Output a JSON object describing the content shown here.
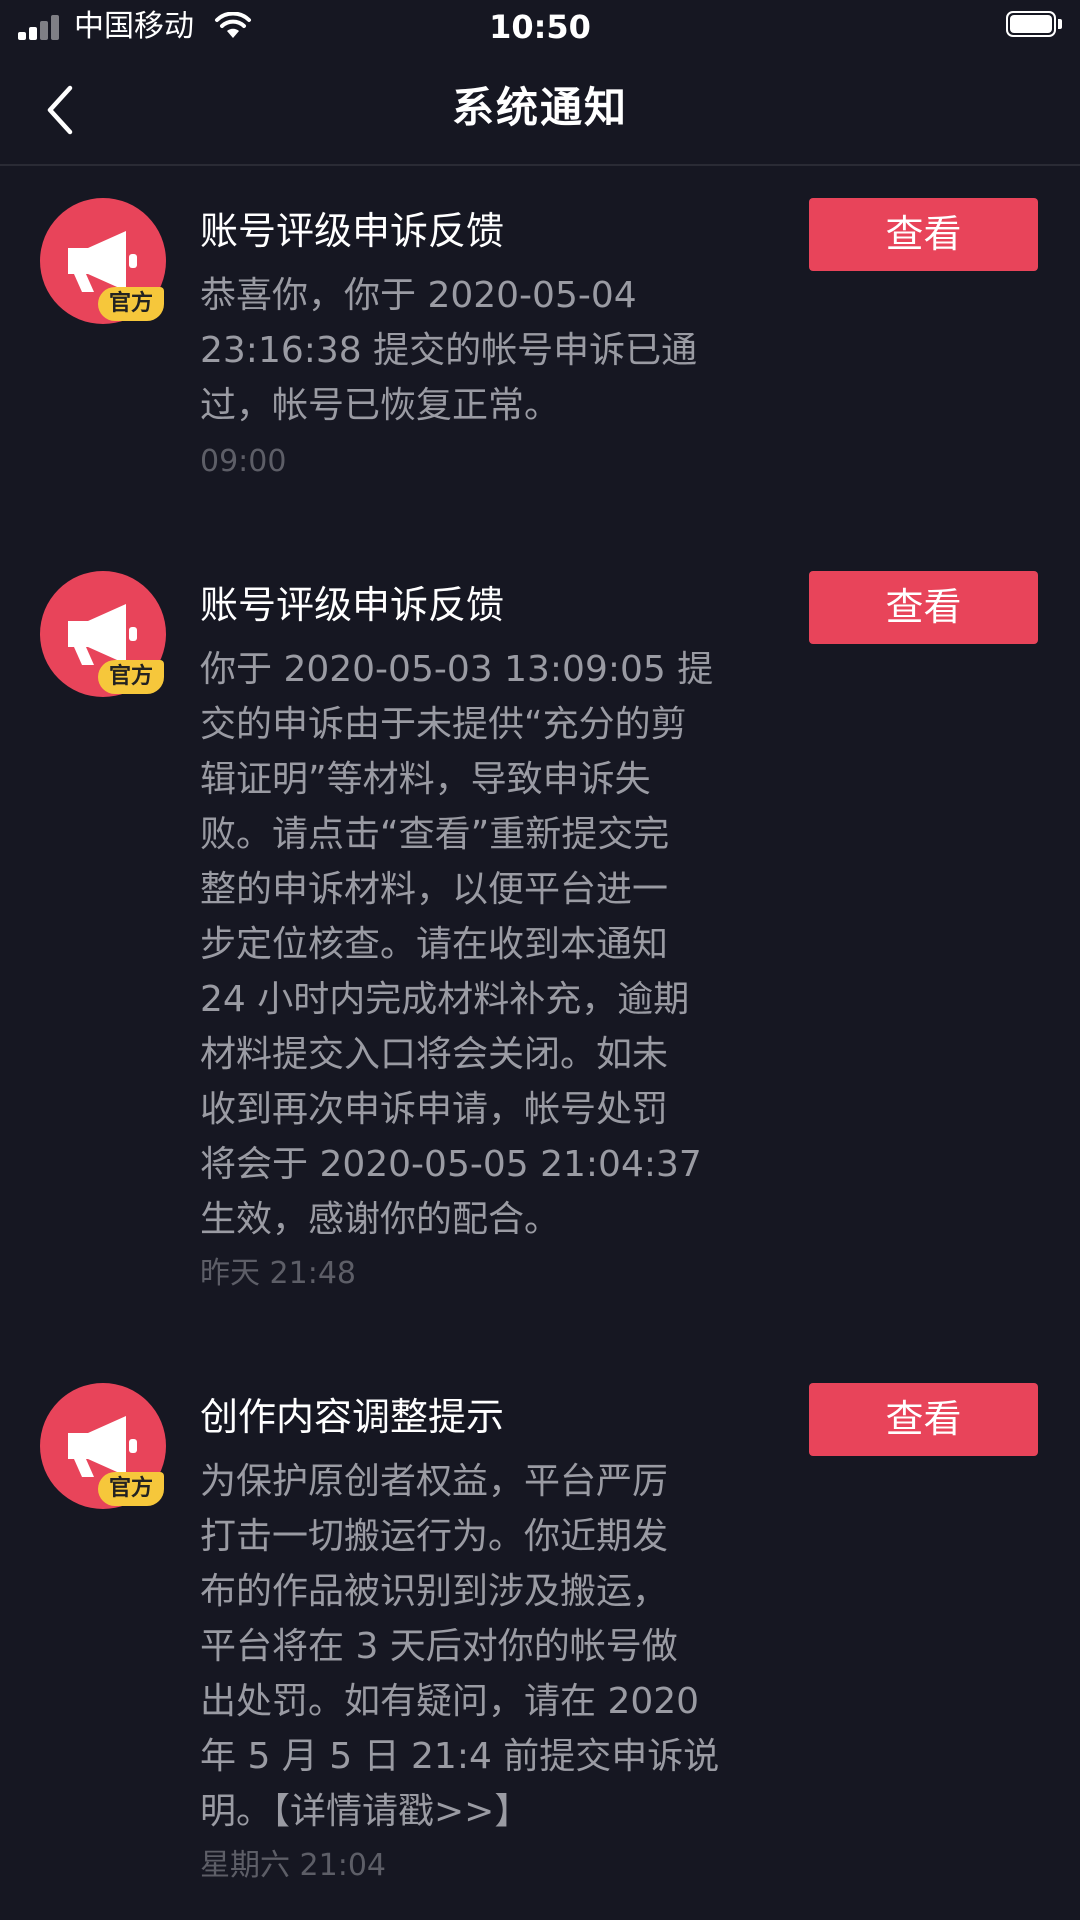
{
  "status_bar": {
    "carrier": "中国移动",
    "time": "10:50",
    "wifi_icon": "wifi-icon",
    "battery_icon": "battery-icon",
    "signal_icon": "signal-icon"
  },
  "nav": {
    "title": "系统通知",
    "back_icon": "chevron-left-icon"
  },
  "notifications": [
    {
      "badge": "官方",
      "title": "账号评级申诉反馈",
      "body_lines": [
        "恭喜你，你于 2020-05-04",
        "23:16:38 提交的帐号申诉已通",
        "过，帐号已恢复正常。"
      ],
      "time": "09:00",
      "button": "查看",
      "icon": "megaphone-icon"
    },
    {
      "badge": "官方",
      "title": "账号评级申诉反馈",
      "body_lines": [
        "你于 2020-05-03 13:09:05 提",
        "交的申诉由于未提供“充分的剪",
        "辑证明”等材料，导致申诉失",
        "败。请点击“查看”重新提交完",
        "整的申诉材料，以便平台进一",
        "步定位核查。请在收到本通知",
        "24 小时内完成材料补充，逾期",
        "材料提交入口将会关闭。如未",
        "收到再次申诉申请，帐号处罚",
        "将会于 2020-05-05 21:04:37",
        "生效，感谢你的配合。"
      ],
      "time": "昨天 21:48",
      "button": "查看",
      "icon": "megaphone-icon"
    },
    {
      "badge": "官方",
      "title": "创作内容调整提示",
      "body_lines": [
        "为保护原创者权益，平台严厉",
        "打击一切搬运行为。你近期发",
        "布的作品被识别到涉及搬运，",
        "平台将在 3 天后对你的帐号做",
        "出处罚。如有疑问，请在 2020",
        "年 5 月 5 日 21:4 前提交申诉说",
        "明。【详情请戳>>】"
      ],
      "time": "星期六 21:04",
      "button": "查看",
      "icon": "megaphone-icon"
    }
  ],
  "colors": {
    "background": "#161722",
    "accent": "#e8445a",
    "badge": "#f6c73b",
    "body_text": "#9a9ba3",
    "time_text": "#5d5e67"
  }
}
